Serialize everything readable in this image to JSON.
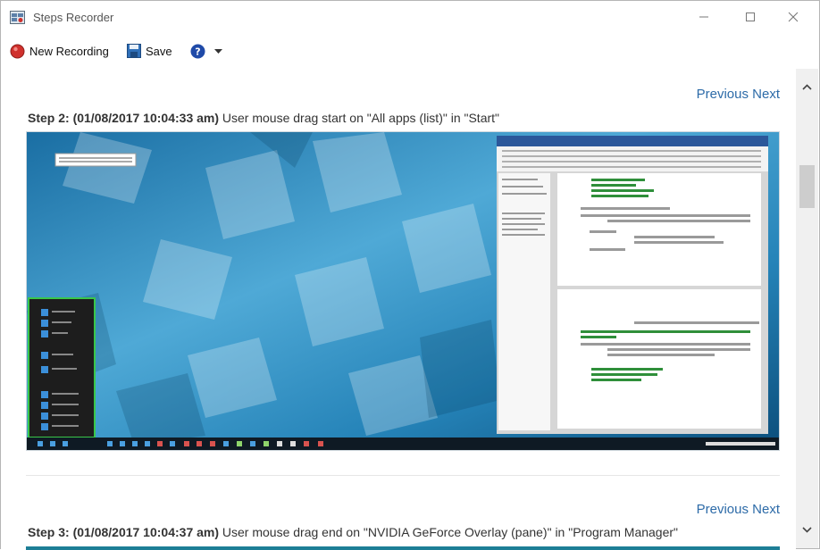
{
  "window": {
    "title": "Steps Recorder"
  },
  "toolbar": {
    "new_recording": "New Recording",
    "save": "Save"
  },
  "steps": [
    {
      "nav_previous": "Previous",
      "nav_next": "Next",
      "label": "Step 2: (01/08/2017 10:04:33 am)",
      "description": "User mouse drag start on \"All apps (list)\" in \"Start\""
    },
    {
      "nav_previous": "Previous",
      "nav_next": "Next",
      "label": "Step 3: (01/08/2017 10:04:37 am)",
      "description": "User mouse drag end on \"NVIDIA GeForce Overlay (pane)\" in \"Program Manager\""
    }
  ],
  "icons": {
    "app": "steps-recorder-icon",
    "record": "record-icon",
    "save": "floppy-disk-icon",
    "help": "help-icon",
    "dropdown": "chevron-down-icon"
  },
  "colors": {
    "link": "#2d6ba8",
    "record": "#d0312d",
    "help": "#1f4aa8",
    "desktop_light": "#5fb4dc",
    "desktop_dark": "#0b4d7a"
  }
}
